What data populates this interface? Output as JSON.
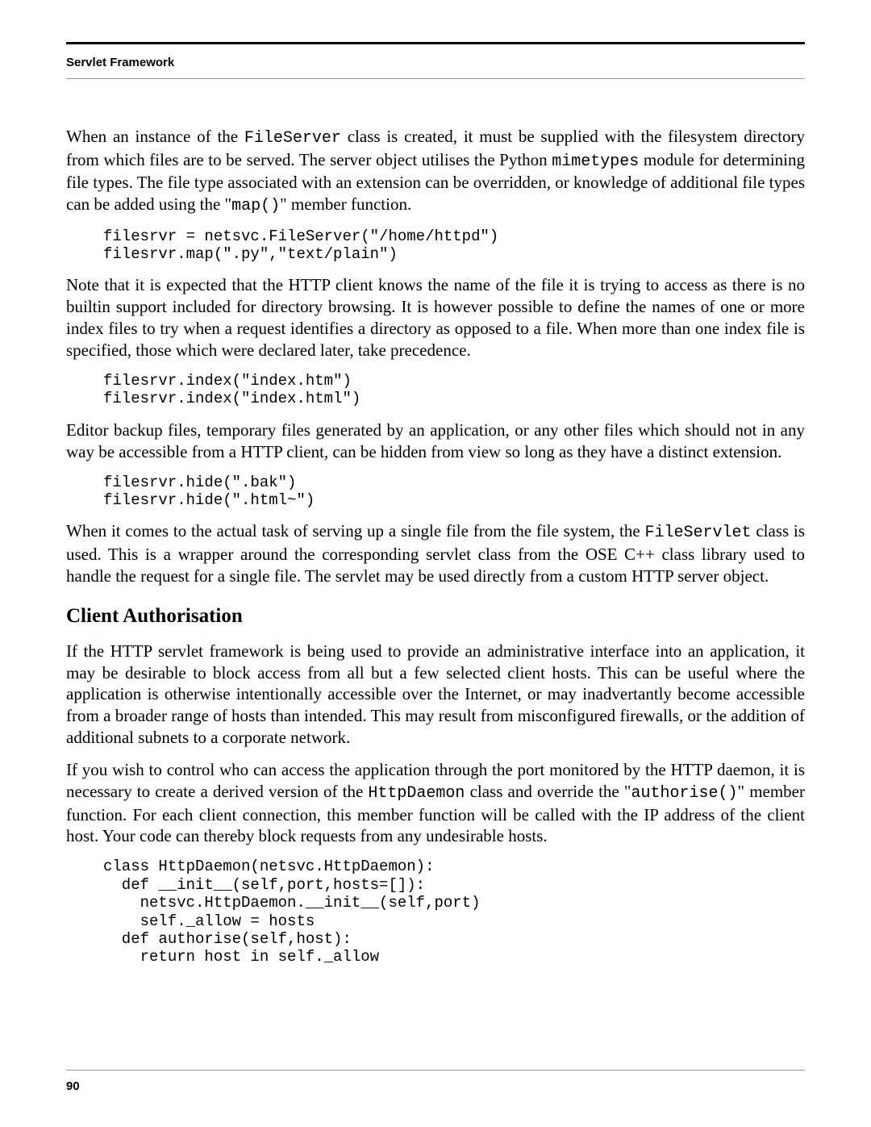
{
  "header": {
    "title": "Servlet Framework"
  },
  "para1": {
    "t1": "When an instance of the ",
    "c1": "FileServer",
    "t2": " class is created, it must be supplied with the filesystem directory from which files are to be served. The server object utilises the Python ",
    "c2": "mimetypes",
    "t3": " module for determining file types. The file type associated with an extension can be overridden, or knowledge of additional file types can be added using the \"",
    "c3": "map()",
    "t4": "\" member function."
  },
  "code1": "filesrvr = netsvc.FileServer(\"/home/httpd\")\nfilesrvr.map(\".py\",\"text/plain\")",
  "para2": "Note that it is expected that the HTTP client knows the name of the file it is trying to access as there is no builtin support included for directory browsing. It is however possible to define the names of one or more index files to try when a request identifies a directory as opposed to a file. When more than one index file is specified, those which were declared later, take precedence.",
  "code2": "filesrvr.index(\"index.htm\")\nfilesrvr.index(\"index.html\")",
  "para3": "Editor backup files, temporary files generated by an application, or any other files which should not in any way be accessible from a HTTP client, can be hidden from view so long as they have a distinct extension.",
  "code3": "filesrvr.hide(\".bak\")\nfilesrvr.hide(\".html~\")",
  "para4": {
    "t1": "When it comes to the actual task of serving up a single file from the file system, the ",
    "c1": "FileServlet",
    "t2": " class is used. This is a wrapper around the corresponding servlet class from the OSE C++ class library used to handle the request for a single file. The servlet may be used directly from a custom HTTP server object."
  },
  "section_heading": "Client Authorisation",
  "para5": "If the HTTP servlet framework is being used to provide an administrative interface into an application, it may be desirable to block access from all but a few selected client hosts. This can be useful where the application is otherwise intentionally accessible over the Internet, or may inadvertantly become accessible from a broader range of hosts than intended. This may result from misconfigured firewalls, or the addition of additional subnets to a corporate network.",
  "para6": {
    "t1": "If you wish to control who can access the application through the port monitored by the HTTP daemon, it is necessary to create a derived version of the ",
    "c1": "HttpDaemon",
    "t2": " class and override the \"",
    "c2": "authorise()",
    "t3": "\" member function. For each client connection, this member function will be called with the IP address of the client host. Your code can thereby block requests from any undesirable hosts."
  },
  "code4": "class HttpDaemon(netsvc.HttpDaemon):\n  def __init__(self,port,hosts=[]):\n    netsvc.HttpDaemon.__init__(self,port)\n    self._allow = hosts\n  def authorise(self,host):\n    return host in self._allow",
  "page_number": "90"
}
